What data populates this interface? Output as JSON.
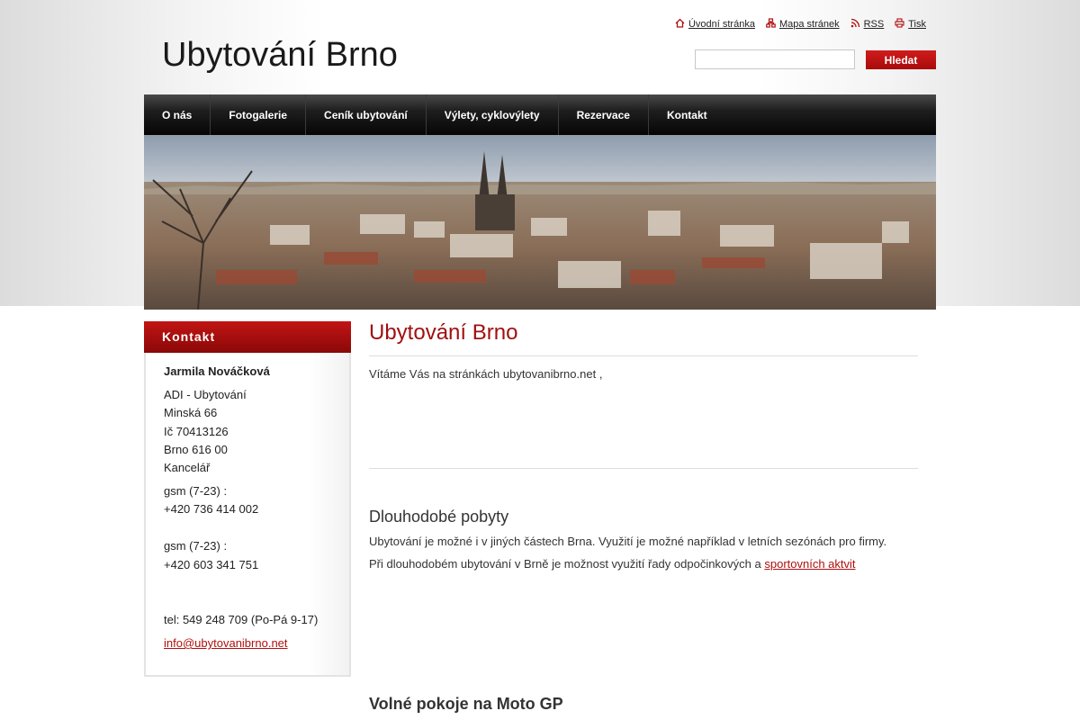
{
  "header": {
    "site_title": "Ubytování Brno",
    "toplinks": [
      {
        "label": "Úvodní stránka",
        "icon": "home-icon"
      },
      {
        "label": "Mapa stránek",
        "icon": "sitemap-icon"
      },
      {
        "label": "RSS",
        "icon": "rss-icon"
      },
      {
        "label": "Tisk",
        "icon": "print-icon"
      }
    ],
    "search": {
      "value": "",
      "button_label": "Hledat"
    }
  },
  "nav": {
    "items": [
      "O nás",
      "Fotogalerie",
      "Ceník ubytování",
      "Výlety, cyklovýlety",
      "Rezervace",
      "Kontakt"
    ]
  },
  "sidebar": {
    "title": "Kontakt",
    "name": "Jarmila Nováčková",
    "address_lines": [
      "ADI - Ubytování",
      "Minská 66",
      "Ič 70413126",
      "Brno 616 00",
      "Kancelář"
    ],
    "gsm1_label": "gsm (7-23) :",
    "gsm1_number": "+420 736 414 002",
    "gsm2_label": "gsm (7-23) :",
    "gsm2_number": "+420 603 341 751",
    "tel": "tel: 549 248 709 (Po-Pá 9-17)",
    "email": "info@ubytovanibrno.net"
  },
  "main": {
    "title": "Ubytování Brno",
    "welcome": "Vítáme Vás na stránkách ubytovanibrno.net ,",
    "section1_title": "Dlouhodobé pobyty",
    "section1_p1": "Ubytování je možné i v jiných částech Brna. Využití je možné například v letních sezónách pro firmy.",
    "section1_p2_text": "Při dlouhodobém ubytování v Brně je možnost využití řady odpočinkových a ",
    "section1_p2_link": "sportovních aktvit",
    "section2_title": "Volné pokoje na Moto GP"
  },
  "colors": {
    "accent_red": "#a01010",
    "nav_dark": "#050505"
  }
}
